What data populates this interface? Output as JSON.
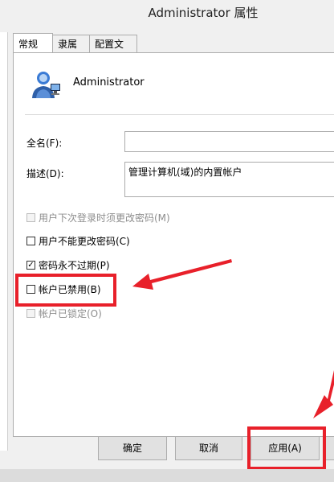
{
  "window": {
    "title": "Administrator 属性"
  },
  "tabs": [
    {
      "label": "常规",
      "active": true
    },
    {
      "label": "隶属于",
      "active": false
    },
    {
      "label": "配置文件",
      "active": false
    }
  ],
  "user": {
    "name": "Administrator",
    "icon": "user-icon"
  },
  "fields": {
    "fullname_label": "全名(F):",
    "fullname_value": "",
    "description_label": "描述(D):",
    "description_value": "管理计算机(域)的内置帐户"
  },
  "options": [
    {
      "label": "用户下次登录时须更改密码(M)",
      "checked": false,
      "enabled": false
    },
    {
      "label": "用户不能更改密码(C)",
      "checked": false,
      "enabled": true
    },
    {
      "label": "密码永不过期(P)",
      "checked": true,
      "enabled": true
    },
    {
      "label": "帐户已禁用(B)",
      "checked": false,
      "enabled": true
    },
    {
      "label": "帐户已锁定(O)",
      "checked": false,
      "enabled": false
    }
  ],
  "buttons": {
    "ok": "确定",
    "cancel": "取消",
    "apply": "应用(A)"
  },
  "colors": {
    "highlight": "#e8202a"
  }
}
